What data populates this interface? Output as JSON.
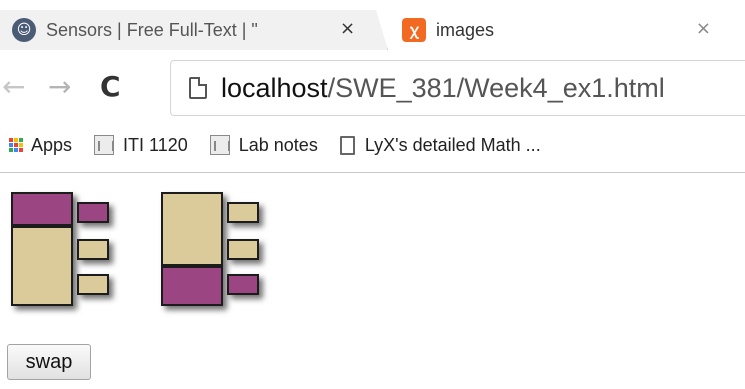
{
  "tabs": [
    {
      "title": "Sensors | Free Full-Text | \"",
      "close": "×",
      "favicon": "mdpi-favicon"
    },
    {
      "title": "images",
      "close": "×",
      "favicon": "xampp-favicon"
    }
  ],
  "toolbar": {
    "back": "←",
    "forward": "→",
    "reload": "C",
    "url_host": "localhost",
    "url_path": "/SWE_381/Week4_ex1.html"
  },
  "bookmarks": [
    {
      "label": "Apps",
      "icon": "apps-grid-icon"
    },
    {
      "label": "ITI 1120",
      "icon": "institution-icon"
    },
    {
      "label": "Lab notes",
      "icon": "institution-icon"
    },
    {
      "label": "LyX's detailed Math ...",
      "icon": "page-icon"
    }
  ],
  "page": {
    "swap_label": "swap"
  },
  "colors": {
    "tan": "#dccb9a",
    "purple": "#9b4583",
    "outline": "#1c1c1c",
    "apps_dots": [
      "#ea4335",
      "#fbbc05",
      "#34a853",
      "#4285f4",
      "#ea4335",
      "#fbbc05",
      "#34a853",
      "#4285f4",
      "#ea4335"
    ]
  }
}
